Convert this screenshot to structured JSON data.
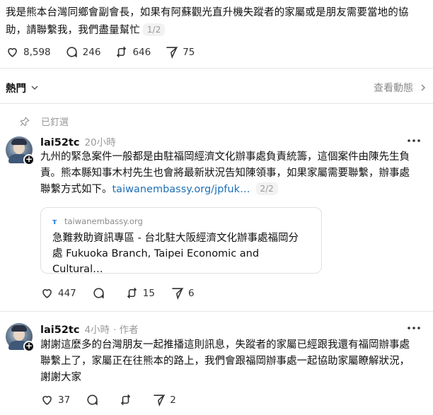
{
  "top_post": {
    "text_line1": "我是熊本台灣同鄉會副會長，如果有阿蘇觀光直升機失蹤者的家屬或是朋友需要當地的協",
    "text_line2": "助，請聯繫我，我們盡量幫忙",
    "page_indicator": "1/2",
    "likes": "8,598",
    "replies": "246",
    "reposts": "646",
    "shares": "75"
  },
  "sort_bar": {
    "label": "熱門",
    "activity_link": "查看動態"
  },
  "pinned_label": "已釘選",
  "replies": [
    {
      "username": "lai52tc",
      "time": "20小時",
      "text_lines": [
        "九州的緊急案件一般都是由駐福岡經濟文化辦事處負責統籌，這個案件由陳先生負",
        "責。熊本縣知事木村先生也會將最新狀況告知陳領事，如果家屬需要聯繫，辦事處",
        "聯繫方式如下。"
      ],
      "link_text": "taiwanembassy.org/jpfuk…",
      "page_indicator": "2/2",
      "card": {
        "domain": "taiwanembassy.org",
        "title_line1": "急難救助資訊專區 - 台北駐大阪經濟文化辦事處福岡分",
        "title_line2": "處 Fukuoka Branch, Taipei Economic and Cultural…"
      },
      "likes": "447",
      "reposts": "15",
      "shares": "6"
    },
    {
      "username": "lai52tc",
      "time": "4小時",
      "author_tag": "· 作者",
      "text_lines": [
        "謝謝這麼多的台灣朋友一起推播這則訊息，失蹤者的家屬已經跟我還有福岡辦事處",
        "聯繫上了，家屬正在往熊本的路上，我們會跟福岡辦事處一起協助家屬瞭解狀況，",
        "謝謝大家"
      ],
      "likes": "37",
      "reposts": "",
      "shares": "2"
    }
  ],
  "icons": {
    "like": "heart-icon",
    "reply": "comment-icon",
    "repost": "repost-icon",
    "share": "send-icon",
    "pin": "pin-icon",
    "more": "more-icon"
  },
  "colors": {
    "link": "#1d6fb8",
    "muted": "#999999",
    "text": "#101010"
  }
}
